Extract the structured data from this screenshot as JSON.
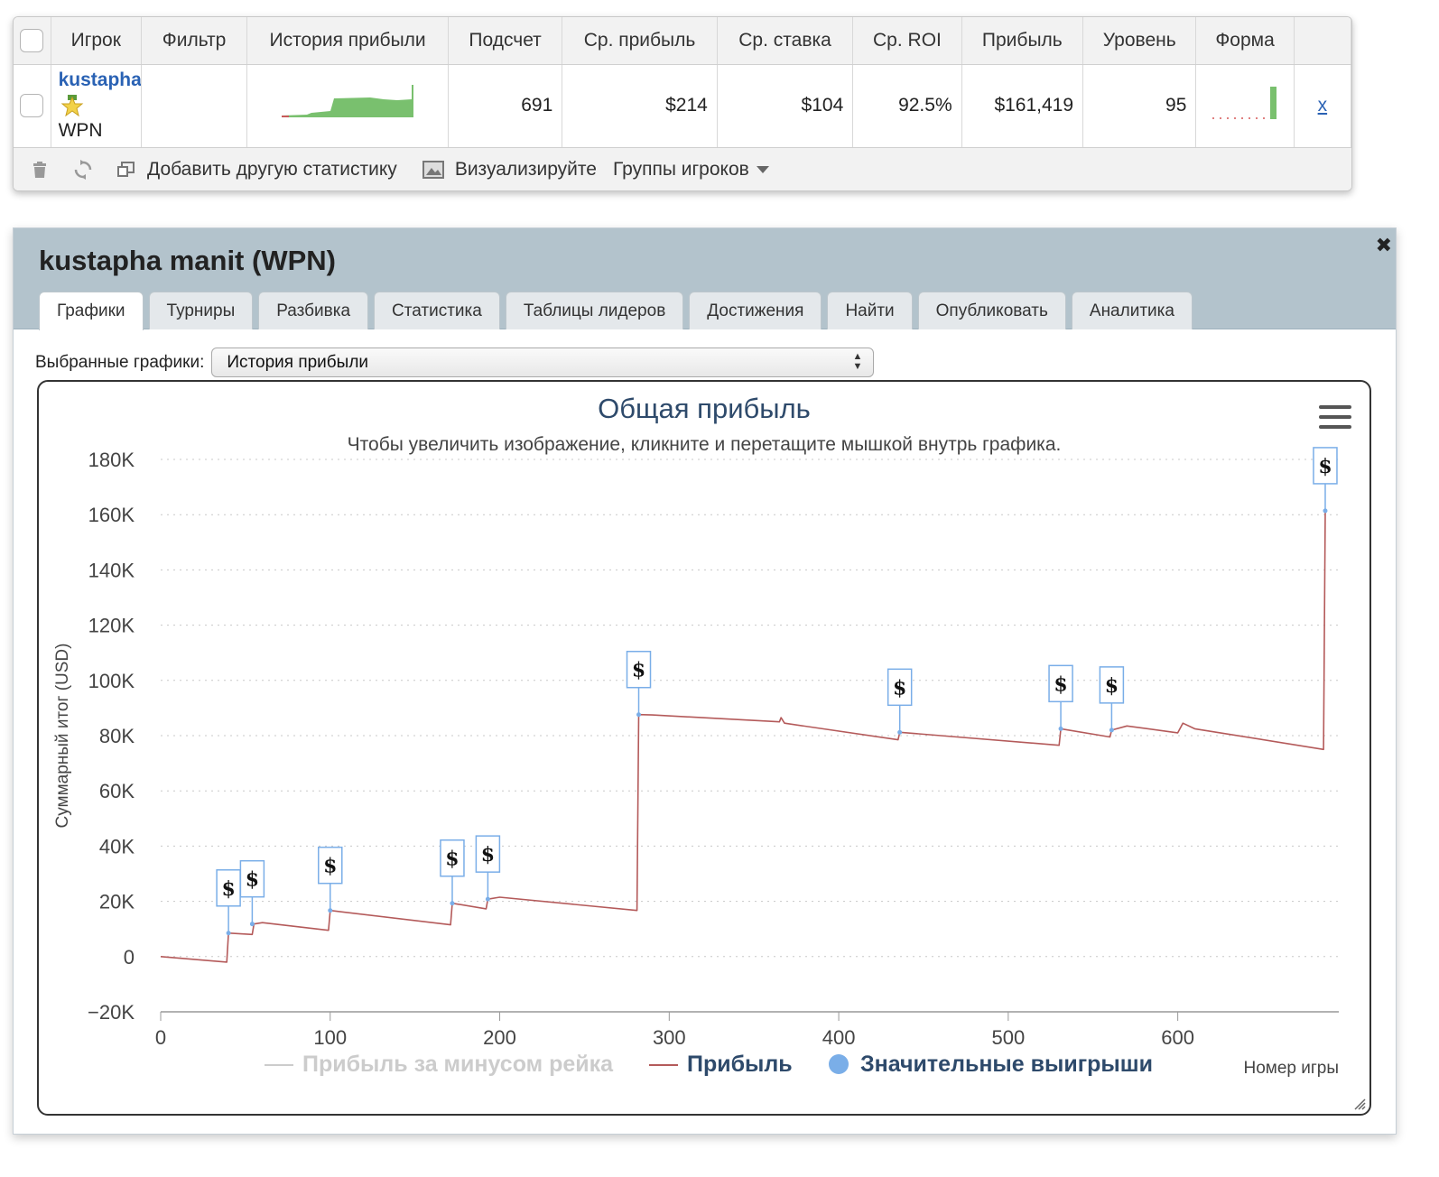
{
  "stats_table": {
    "columns": [
      "Игрок",
      "Фильтр",
      "История прибыли",
      "Подсчет",
      "Ср. прибыль",
      "Ср. ставка",
      "Ср. ROI",
      "Прибыль",
      "Уровень",
      "Форма"
    ],
    "row": {
      "player_name": "kustapha",
      "network": "WPN",
      "count": "691",
      "avg_profit": "$214",
      "avg_stake": "$104",
      "avg_roi": "92.5%",
      "profit": "$161,419",
      "level": "95",
      "remove_label": "x"
    },
    "toolbar": {
      "add_stats": "Добавить другую статистику",
      "visualize": "Визуализируйте",
      "player_groups": "Группы игроков"
    },
    "colors": {
      "sparkline": "#79c06e"
    }
  },
  "dialog": {
    "title": "kustapha manit (WPN)",
    "close_label": "✖",
    "tabs": [
      "Графики",
      "Турниры",
      "Разбивка",
      "Статистика",
      "Таблицы лидеров",
      "Достижения",
      "Найти",
      "Опубликовать",
      "Аналитика"
    ],
    "active_tab": "Графики",
    "chart_select": {
      "label": "Выбранные графики:",
      "value": "История прибыли"
    }
  },
  "chart_data": {
    "type": "line",
    "title": "Общая прибыль",
    "subtitle": "Чтобы увеличить изображение, кликните и перетащите мышкой внутрь графика.",
    "xlabel": "Номер игры",
    "ylabel": "Суммарный итог (USD)",
    "xlim": [
      0,
      695
    ],
    "ylim": [
      -20000,
      180000
    ],
    "x_ticks": [
      0,
      100,
      200,
      300,
      400,
      500,
      600
    ],
    "y_ticks": [
      -20000,
      0,
      20000,
      40000,
      60000,
      80000,
      100000,
      120000,
      140000,
      160000,
      180000
    ],
    "y_tick_labels": [
      "−20K",
      "0",
      "20K",
      "40K",
      "60K",
      "80K",
      "100K",
      "120K",
      "140K",
      "160K",
      "180K"
    ],
    "grid": true,
    "legend": [
      "Прибыль за минусом рейка",
      "Прибыль",
      "Значительные выигрыши"
    ],
    "legend_position": "bottom",
    "colors": {
      "profit": "#b45a5a",
      "big_win": "#7aaee8",
      "disabled": "#cccccc",
      "title": "#2e4a6b"
    },
    "series": [
      {
        "name": "Прибыль",
        "x": [
          0,
          39,
          40,
          54,
          55,
          60,
          99,
          100,
          171,
          172,
          192,
          193,
          200,
          281,
          282,
          290,
          365,
          366,
          368,
          435,
          436,
          530,
          531,
          560,
          561,
          570,
          600,
          603,
          610,
          686,
          687
        ],
        "y": [
          0,
          -2000,
          8500,
          8000,
          11800,
          12300,
          9500,
          16700,
          11500,
          19300,
          17300,
          20800,
          21500,
          16700,
          87600,
          87500,
          85000,
          86500,
          84500,
          78500,
          81200,
          76500,
          82500,
          79500,
          82000,
          83500,
          81000,
          84500,
          82500,
          75000,
          161400
        ]
      }
    ],
    "big_wins": [
      {
        "x": 40,
        "y": 8500,
        "label": "$"
      },
      {
        "x": 54,
        "y": 11800,
        "label": "$"
      },
      {
        "x": 100,
        "y": 16700,
        "label": "$"
      },
      {
        "x": 172,
        "y": 19300,
        "label": "$"
      },
      {
        "x": 193,
        "y": 20800,
        "label": "$"
      },
      {
        "x": 282,
        "y": 87600,
        "label": "$"
      },
      {
        "x": 436,
        "y": 81200,
        "label": "$"
      },
      {
        "x": 531,
        "y": 82500,
        "label": "$"
      },
      {
        "x": 561,
        "y": 82000,
        "label": "$"
      },
      {
        "x": 687,
        "y": 161400,
        "label": "$"
      }
    ]
  }
}
